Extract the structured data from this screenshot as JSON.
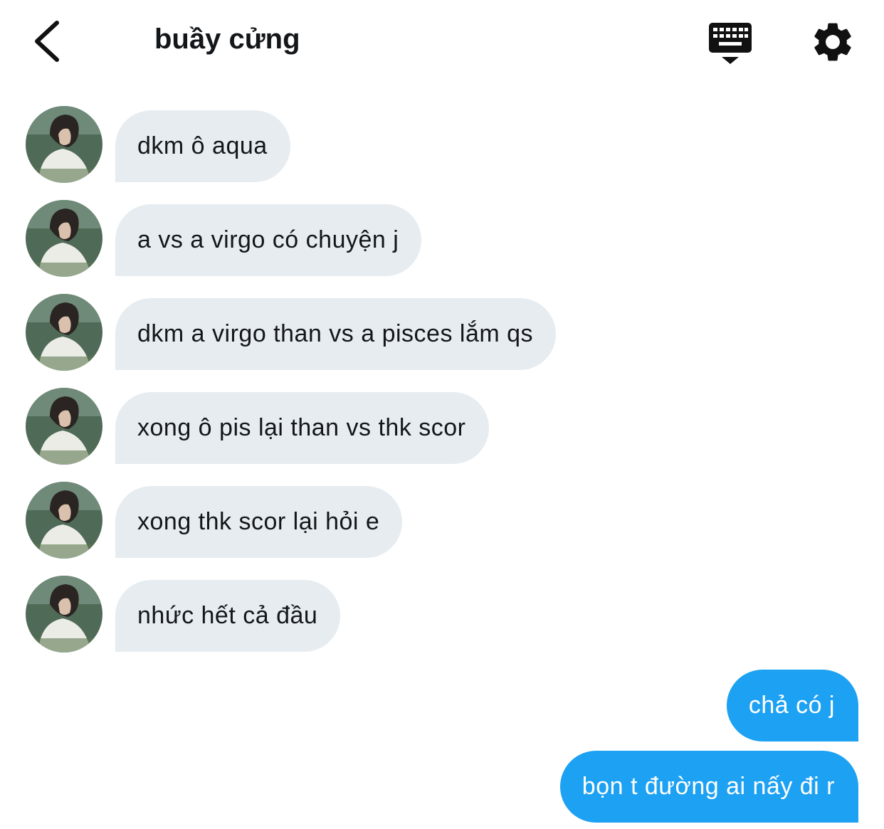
{
  "header": {
    "title": "buầy cửng",
    "back_icon": "chevron-left-icon",
    "keyboard_icon": "keyboard-icon",
    "settings_icon": "gear-icon"
  },
  "colors": {
    "incoming_bubble": "#e6ecf0",
    "outgoing_bubble": "#1da1f2",
    "text": "#14171a"
  },
  "messages": {
    "incoming": [
      {
        "text": "dkm ô aqua"
      },
      {
        "text": "a vs a virgo có chuyện j"
      },
      {
        "text": "dkm a virgo than vs a pisces lắm qs"
      },
      {
        "text": "xong ô pis lại than vs thk scor"
      },
      {
        "text": "xong thk scor lại hỏi e"
      },
      {
        "text": "nhức hết cả đầu"
      }
    ],
    "outgoing": [
      {
        "text": "chả có j"
      },
      {
        "text": "bọn t đường ai nấy đi r"
      }
    ]
  }
}
